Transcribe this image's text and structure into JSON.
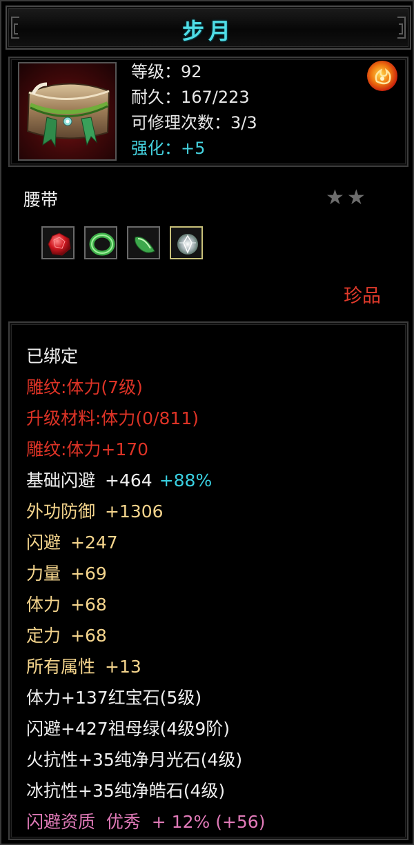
{
  "title": "步月",
  "item": {
    "level": "等级：92",
    "durability": "耐久：167/223",
    "repairs": "可修理次数：3/3",
    "enhance": "强化：+5",
    "type": "腰带",
    "stars_filled": 0,
    "stars_total": 2,
    "rarity": "珍品",
    "badge_icon": "fire-emblem-icon",
    "gem_icons": [
      "ruby-gem-icon",
      "jade-ring-icon",
      "jade-shard-icon",
      "diamond-gem-icon"
    ]
  },
  "attributes": {
    "bound": "已绑定",
    "engrave": "雕纹:体力(7级)",
    "upgrade": "升级材料:体力(0/811)",
    "engrave_bonus": "雕纹:体力+170",
    "base_dodge_name": "基础闪避",
    "base_dodge_val": "+464",
    "base_dodge_pct": "+88%",
    "ext_def_name": "外功防御",
    "ext_def_val": "+1306",
    "dodge_name": "闪避",
    "dodge_val": "+247",
    "str_name": "力量",
    "str_val": "+69",
    "vit_name": "体力",
    "vit_val": "+68",
    "foc_name": "定力",
    "foc_val": "+68",
    "all_name": "所有属性",
    "all_val": "+13",
    "gem1": "体力+137红宝石(5级)",
    "gem2": "闪避+427祖母绿(4级9阶)",
    "gem3": "火抗性+35纯净月光石(4级)",
    "gem4": "冰抗性+35纯净皓石(4级)",
    "quality": "闪避资质  优秀  + 12% (+56)"
  },
  "colors": {
    "title": "#4fdde6",
    "enhance": "#45d3e0",
    "red": "#dd3326",
    "gold": "#f4d48c",
    "pink": "#e07ab8",
    "cyan_pct": "#39cfe0"
  }
}
